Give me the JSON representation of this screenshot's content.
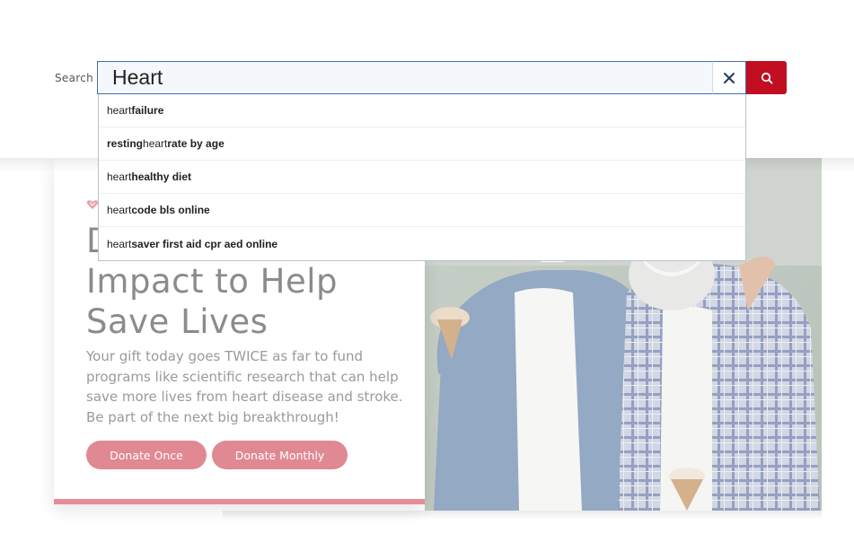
{
  "search": {
    "label": "Search",
    "value": "Heart",
    "clear_icon": "close-icon",
    "submit_icon": "search-icon",
    "suggestions": [
      {
        "bold_before": "",
        "normal": "heart",
        "bold_after": " failure"
      },
      {
        "bold_before": "resting ",
        "normal": "heart",
        "bold_after": " rate by age"
      },
      {
        "bold_before": "",
        "normal": "heart",
        "bold_after": " healthy diet"
      },
      {
        "bold_before": "",
        "normal": "heart",
        "bold_after": "code bls online"
      },
      {
        "bold_before": "",
        "normal": "heart",
        "bold_after": "saver first aid cpr aed online"
      }
    ]
  },
  "hero": {
    "title_lines": [
      "D",
      "Impact to Help",
      "Save Lives"
    ],
    "body": "Your gift today goes TWICE as far to fund programs like scientific research that can help save more lives from heart disease and stroke. Be part of the next big breakthrough!",
    "donate_once": "Donate Once",
    "donate_monthly": "Donate Monthly",
    "image_icon": "photo-grandfather-grandson-icecream"
  },
  "colors": {
    "brand_red": "#c10e21",
    "focus_blue": "#3d6fb5",
    "donate_pink": "#e08993",
    "card_bar": "#e58c96"
  }
}
